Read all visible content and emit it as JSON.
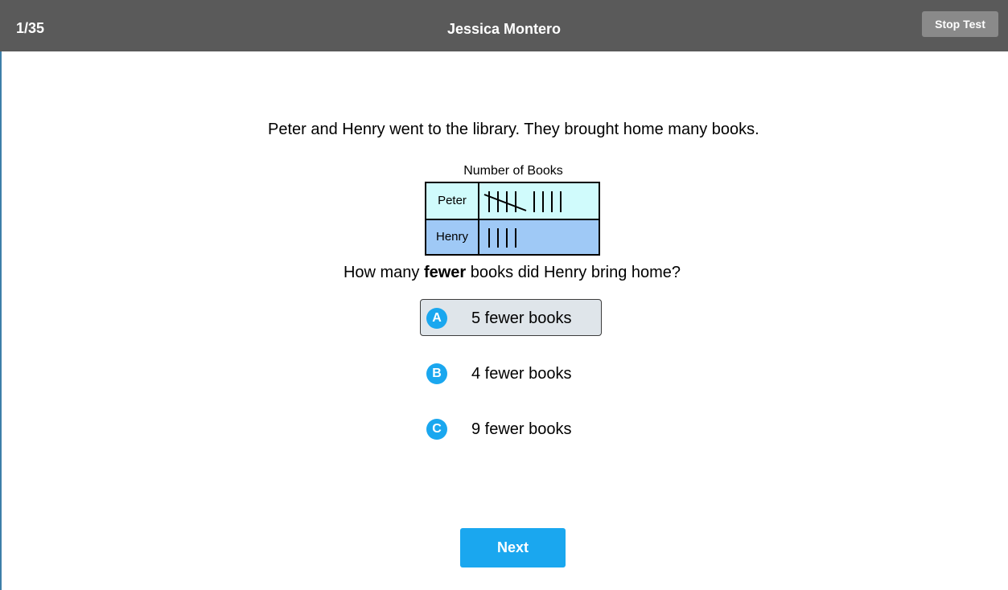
{
  "header": {
    "progress": "1/35",
    "student_name": "Jessica Montero",
    "stop_label": "Stop Test"
  },
  "question": {
    "text": "Peter and Henry went to the library. They brought home many books.",
    "table_title": "Number of Books",
    "rows": [
      {
        "name": "Peter",
        "count": 9
      },
      {
        "name": "Henry",
        "count": 4
      }
    ],
    "prompt_before": "How many ",
    "prompt_bold": "fewer",
    "prompt_after": " books did Henry bring home?"
  },
  "choices": [
    {
      "letter": "A",
      "text": "5 fewer books",
      "selected": true
    },
    {
      "letter": "B",
      "text": "4 fewer books",
      "selected": false
    },
    {
      "letter": "C",
      "text": "9 fewer books",
      "selected": false
    }
  ],
  "footer": {
    "next_label": "Next"
  },
  "colors": {
    "header_bg": "#5a5a5a",
    "accent": "#1aa7ef",
    "peter_row": "#d0fbfc",
    "henry_row": "#9fc9f6"
  }
}
